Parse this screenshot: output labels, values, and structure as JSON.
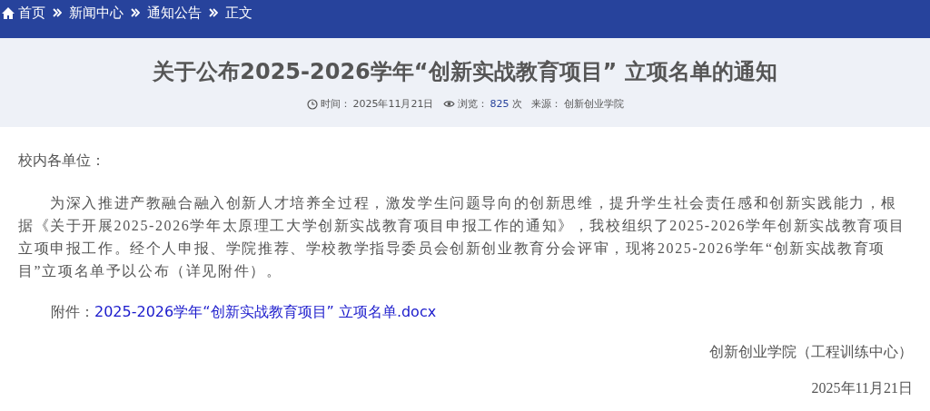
{
  "breadcrumb": [
    {
      "label": "首页",
      "kind": "home"
    },
    {
      "label": "新闻中心",
      "kind": "link"
    },
    {
      "label": "通知公告",
      "kind": "link"
    },
    {
      "label": "正文",
      "kind": "current"
    }
  ],
  "article": {
    "title": "关于公布2025-2026学年“创新实战教育项目” 立项名单的通知",
    "meta": {
      "time_label": "时间：",
      "time": "2025年11月21日",
      "views_label": "浏览：",
      "views": "825",
      "views_unit": "次",
      "source_label": "来源：",
      "source": "创新创业学院"
    },
    "salutation": "校内各单位：",
    "paragraph": "为深入推进产教融合融入创新人才培养全过程，激发学生问题导向的创新思维，提升学生社会责任感和创新实践能力，根据《关于开展2025-2026学年太原理工大学创新实战教育项目申报工作的通知》，我校组织了2025-2026学年创新实战教育项目立项申报工作。经个人申报、学院推荐、学校教学指导委员会创新创业教育分会评审，现将2025-2026学年“创新实战教育项目”立项名单予以公布（详见附件）。",
    "attachment_label": "附件：",
    "attachment": "2025-2026学年“创新实战教育项目” 立项名单.docx",
    "signature": "创新创业学院（工程训练中心）",
    "date": "2025年11月21日"
  }
}
